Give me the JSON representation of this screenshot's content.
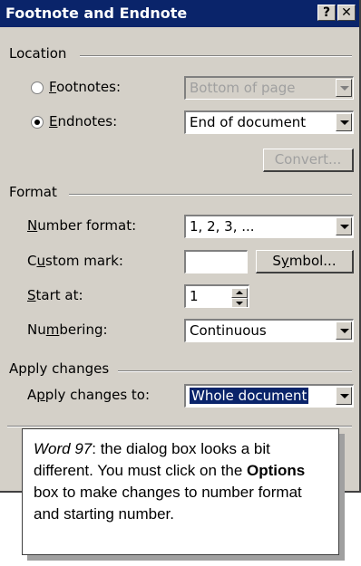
{
  "window": {
    "title": "Footnote and Endnote",
    "help_glyph": "?",
    "close_glyph": "✕"
  },
  "location": {
    "group_label": "Location",
    "footnotes": {
      "label": "Footnotes:",
      "value": "Bottom of page",
      "selected": false
    },
    "endnotes": {
      "label": "Endnotes:",
      "value": "End of document",
      "selected": true
    },
    "convert_label": "Convert..."
  },
  "format": {
    "group_label": "Format",
    "number_format": {
      "label": "Number format:",
      "value": "1, 2, 3, ..."
    },
    "custom_mark": {
      "label": "Custom mark:",
      "value": "",
      "symbol_button": "Symbol..."
    },
    "start_at": {
      "label": "Start at:",
      "value": "1"
    },
    "numbering": {
      "label": "Numbering:",
      "value": "Continuous"
    }
  },
  "apply": {
    "group_label": "Apply changes",
    "apply_to": {
      "label": "Apply changes to:",
      "value": "Whole document"
    }
  },
  "note": {
    "italic": "Word 97",
    "text1": ": the dialog box looks a bit different. You must click on the ",
    "bold": "Options",
    "text2": " box to make changes to number format and starting number."
  }
}
